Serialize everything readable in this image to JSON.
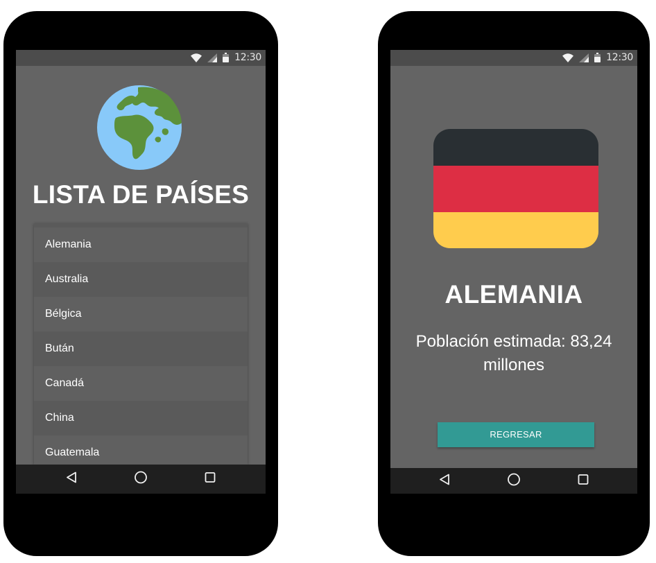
{
  "status_bar": {
    "time": "12:30"
  },
  "list_screen": {
    "title": "LISTA DE PAÍSES",
    "countries": [
      "Alemania",
      "Australia",
      "Bélgica",
      "Bután",
      "Canadá",
      "China",
      "Guatemala"
    ]
  },
  "detail_screen": {
    "country": "ALEMANIA",
    "population": "Población estimada: 83,24 millones",
    "back_button": "REGRESAR",
    "flag_colors": [
      "#292f33",
      "#dd2e44",
      "#ffcc4d"
    ]
  },
  "colors": {
    "screen_bg": "#646464",
    "status_bar_bg": "#4c4c4c",
    "nav_bar_bg": "#1f1f1f",
    "button_bg": "#329a94",
    "globe_ocean": "#88c9f9",
    "globe_land": "#5c913b"
  },
  "icons": {
    "status": [
      "wifi-icon",
      "signal-icon",
      "battery-icon"
    ],
    "nav": [
      "back-triangle-icon",
      "home-circle-icon",
      "recents-square-icon"
    ],
    "app": "globe-icon"
  }
}
